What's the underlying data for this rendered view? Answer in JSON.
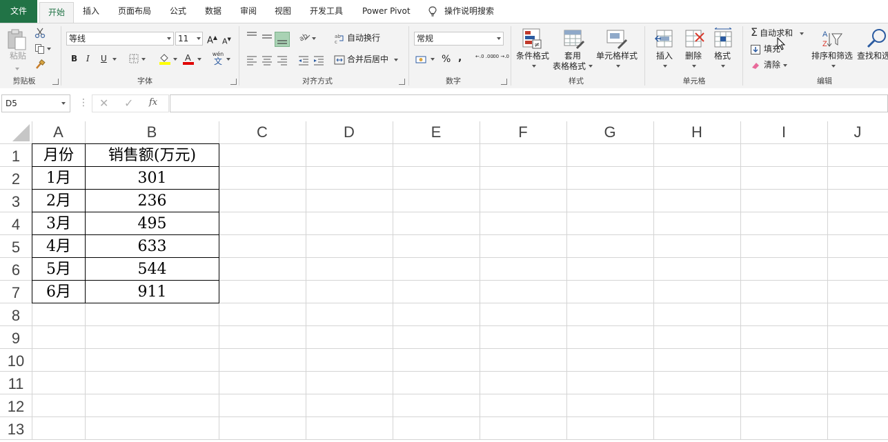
{
  "tabs": [
    "文件",
    "开始",
    "插入",
    "页面布局",
    "公式",
    "数据",
    "审阅",
    "视图",
    "开发工具",
    "Power Pivot"
  ],
  "active_tab": "开始",
  "tell_me": "操作说明搜索",
  "clipboard": {
    "paste": "粘贴",
    "group": "剪贴板"
  },
  "font": {
    "name": "等线",
    "size": "11",
    "group": "字体",
    "grow": "A",
    "shrink": "A",
    "bold": "B",
    "italic": "I",
    "underline": "U",
    "phonetic": "wén",
    "phonetic_char": "文"
  },
  "alignment": {
    "wrap": "自动换行",
    "merge": "合并后居中",
    "group": "对齐方式"
  },
  "number": {
    "format": "常规",
    "percent": "%",
    "comma": ",",
    "inc_decimal": "←.0 .00",
    "dec_decimal": ".00 →.0",
    "group": "数字"
  },
  "styles": {
    "conditional": "条件格式",
    "table_line1": "套用",
    "table_line2": "表格格式",
    "cell_styles": "单元格样式",
    "group": "样式"
  },
  "cells": {
    "insert": "插入",
    "delete": "删除",
    "format": "格式",
    "group": "单元格"
  },
  "editing": {
    "autosum": "自动求和",
    "fill": "填充",
    "clear": "清除",
    "sort": "排序和筛选",
    "find": "查找和选",
    "group": "编辑"
  },
  "formula_bar": {
    "name_box": "D5",
    "fx": "fx",
    "value": ""
  },
  "grid": {
    "columns": [
      "A",
      "B",
      "C",
      "D",
      "E",
      "F",
      "G",
      "H",
      "I",
      "J"
    ],
    "rows": [
      "1",
      "2",
      "3",
      "4",
      "5",
      "6",
      "7",
      "8",
      "9",
      "10",
      "11",
      "12",
      "13"
    ],
    "data": [
      [
        "月份",
        "销售额(万元)"
      ],
      [
        "1月",
        "301"
      ],
      [
        "2月",
        "236"
      ],
      [
        "3月",
        "495"
      ],
      [
        "4月",
        "633"
      ],
      [
        "5月",
        "544"
      ],
      [
        "6月",
        "911"
      ]
    ]
  },
  "colors": {
    "brand": "#217346",
    "ribbon": "#f3f3f3",
    "gridline": "#d4d4d4"
  }
}
